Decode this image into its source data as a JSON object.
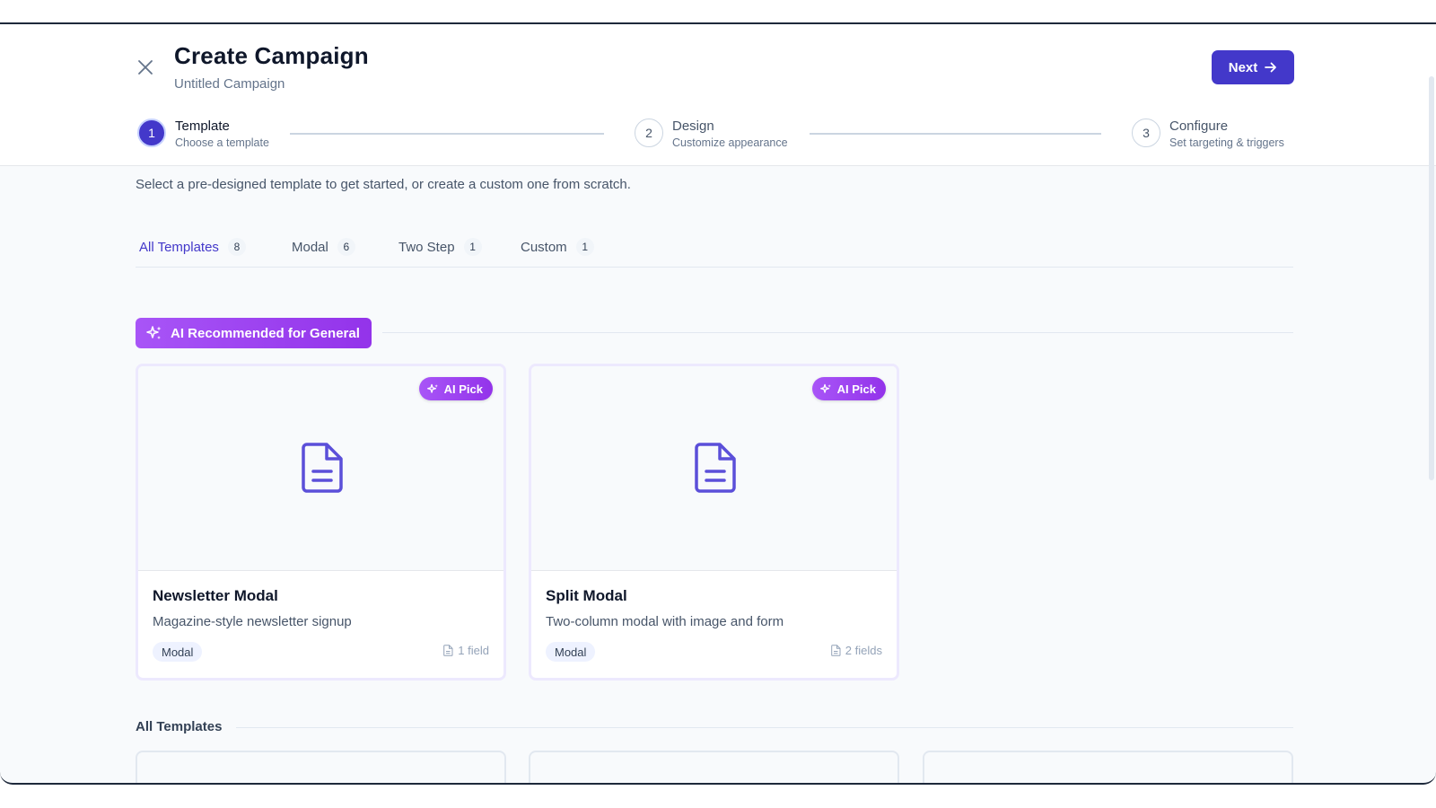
{
  "header": {
    "title": "Create Campaign",
    "subtitle": "Untitled Campaign",
    "next_label": "Next"
  },
  "steps": [
    {
      "number": "1",
      "label": "Template",
      "desc": "Choose a template"
    },
    {
      "number": "2",
      "label": "Design",
      "desc": "Customize appearance"
    },
    {
      "number": "3",
      "label": "Configure",
      "desc": "Set targeting & triggers"
    }
  ],
  "main": {
    "description": "Select a pre-designed template to get started, or create a custom one from scratch.",
    "tabs": [
      {
        "label": "All Templates",
        "count": "8"
      },
      {
        "label": "Modal",
        "count": "6"
      },
      {
        "label": "Two Step",
        "count": "1"
      },
      {
        "label": "Custom",
        "count": "1"
      }
    ],
    "ai_banner": "AI Recommended for General",
    "cards": [
      {
        "badge": "AI Pick",
        "title": "Newsletter Modal",
        "desc": "Magazine-style newsletter signup",
        "tag": "Modal",
        "fields": "1 field"
      },
      {
        "badge": "AI Pick",
        "title": "Split Modal",
        "desc": "Two-column modal with image and form",
        "tag": "Modal",
        "fields": "2 fields"
      }
    ],
    "all_heading": "All Templates"
  },
  "colors": {
    "accent": "#4338ca",
    "ai_purple": "#a855f7"
  }
}
